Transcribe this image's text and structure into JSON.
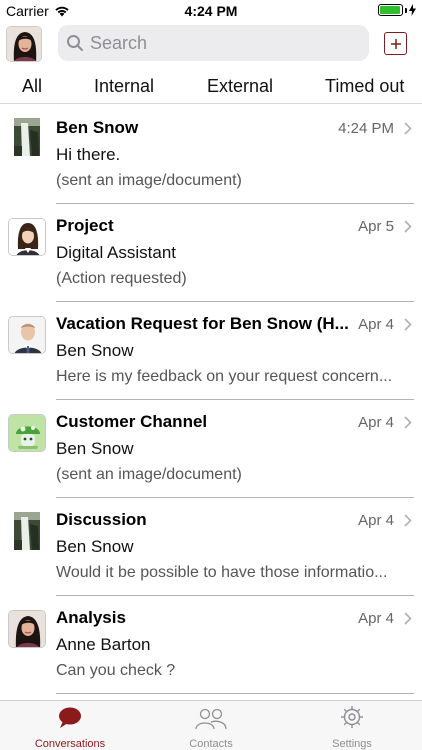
{
  "status_bar": {
    "carrier": "Carrier",
    "time": "4:24 PM",
    "battery_level": 0.95
  },
  "header": {
    "search_placeholder": "Search",
    "add_icon": "plus-square-icon"
  },
  "filters": [
    "All",
    "Internal",
    "External",
    "Timed out"
  ],
  "conversations": [
    {
      "title": "Ben Snow",
      "date": "4:24 PM",
      "line2": "Hi there.",
      "line3": "(sent an image/document)",
      "avatar": "waterfall-image"
    },
    {
      "title": "Project",
      "date": "Apr 5",
      "line2": "Digital Assistant",
      "line3": "(Action requested)",
      "avatar": "woman-cartoon-avatar"
    },
    {
      "title": "Vacation Request for Ben Snow (H...",
      "date": "Apr 4",
      "line2": "Ben Snow",
      "line3": "Here is my feedback on your request concern...",
      "avatar": "man-photo-avatar"
    },
    {
      "title": "Customer Channel",
      "date": "Apr 4",
      "line2": "Ben Snow",
      "line3": "(sent an image/document)",
      "avatar": "mushroom-bot-avatar"
    },
    {
      "title": "Discussion",
      "date": "Apr 4",
      "line2": "Ben Snow",
      "line3": "Would it be possible to have those informatio...",
      "avatar": "waterfall-image"
    },
    {
      "title": "Analysis",
      "date": "Apr 4",
      "line2": "Anne Barton",
      "line3": "Can you check ?",
      "avatar": "woman-photo-avatar"
    }
  ],
  "tabbar": [
    {
      "label": "Conversations",
      "icon": "speech-bubble-icon",
      "active": true
    },
    {
      "label": "Contacts",
      "icon": "people-icon",
      "active": false
    },
    {
      "label": "Settings",
      "icon": "gear-icon",
      "active": false
    }
  ],
  "colors": {
    "accent": "#8b1a1a",
    "battery": "#2fbf2f",
    "separator": "#b4b4b4"
  }
}
